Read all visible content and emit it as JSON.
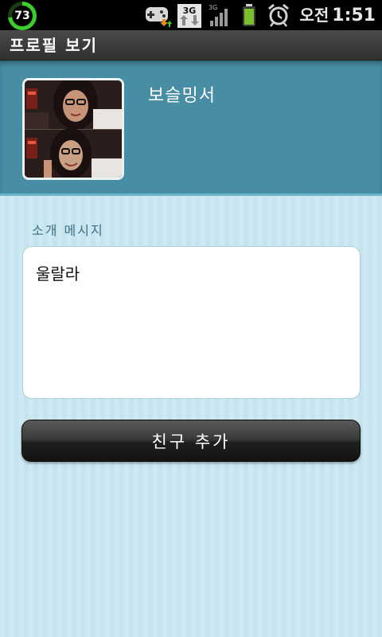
{
  "status_bar": {
    "battery_percent": "73",
    "battery_level": 0.73,
    "network_type": "3G",
    "time_period": "오전",
    "time": "1:51",
    "icons": [
      "gamepad-download-icon",
      "data-3g-icon",
      "signal-icon",
      "battery-icon",
      "alarm-icon"
    ]
  },
  "title_bar": {
    "title": "프로필 보기"
  },
  "profile": {
    "name": "보슬밍서",
    "photo": "avatar-photo"
  },
  "intro": {
    "label": "소개 메시지",
    "message": "울랄라"
  },
  "actions": {
    "add_friend_label": "친구 추가"
  },
  "colors": {
    "header_bg": "#478da4",
    "page_bg": "#cfe9f3",
    "label_color": "#3c6f85",
    "battery_green": "#3ccf2c"
  }
}
